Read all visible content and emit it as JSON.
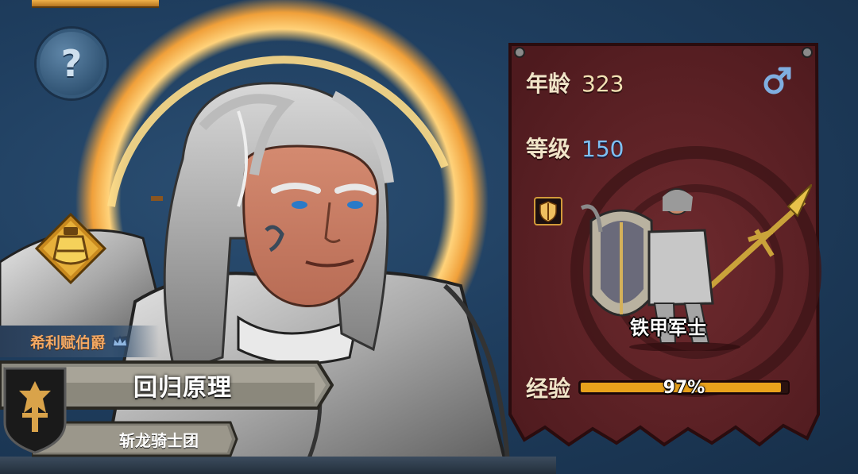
{
  "hero": {
    "rank_title": "希利赋伯爵",
    "name": "回归原理",
    "guild": "斩龙骑士团"
  },
  "stats": {
    "age_label": "年龄",
    "age_value": "323",
    "level_label": "等级",
    "level_value": "150",
    "exp_label": "经验",
    "exp_text": "97%",
    "exp_fraction": 0.97
  },
  "unit": {
    "name": "铁甲军士"
  },
  "icons": {
    "help": "question-mark-icon",
    "gender": "male-symbol-icon",
    "rank": "crown-icon",
    "class": "shield-class-icon",
    "guild": "guild-crest-icon",
    "potion": "potion-icon"
  },
  "colors": {
    "panel": "#5e1f24",
    "level_value": "#7ec0f2",
    "rank_title": "#f2a864",
    "exp_bar_fill": "#e8a21c"
  }
}
